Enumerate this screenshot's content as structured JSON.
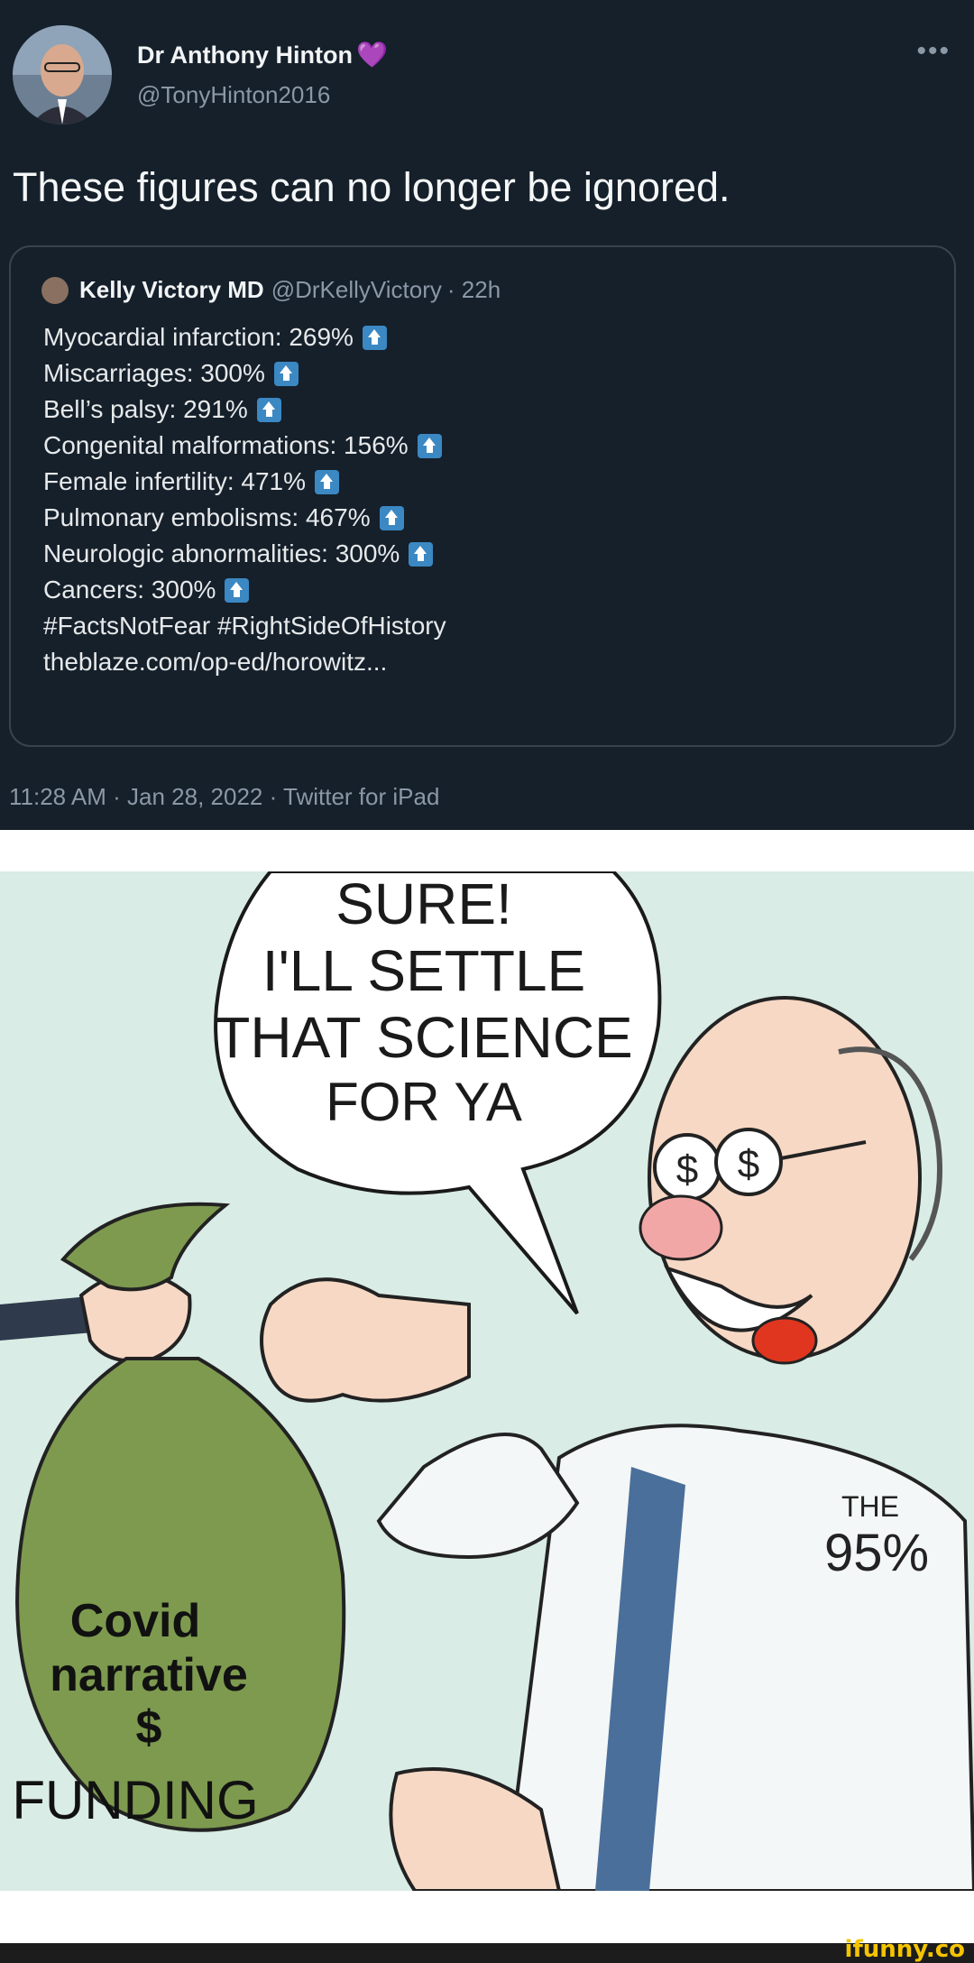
{
  "tweet": {
    "author_name": "Dr Anthony Hinton",
    "author_badge": "💜",
    "author_handle": "@TonyHinton2016",
    "more_icon": "•••",
    "text": "These figures can no longer be ignored.",
    "timestamp": "11:28 AM · Jan 28, 2022 · Twitter for iPad"
  },
  "quote": {
    "author_name": "Kelly Victory MD",
    "author_handle": "@DrKellyVictory",
    "time": "· 22h",
    "lines": [
      {
        "text": "Myocardial infarction: 269%",
        "arrow": true
      },
      {
        "text": "Miscarriages: 300%",
        "arrow": true
      },
      {
        "text": "Bell’s palsy: 291%",
        "arrow": true
      },
      {
        "text": "Congenital malformations: 156%",
        "arrow": true
      },
      {
        "text": "Female infertility: 471%",
        "arrow": true
      },
      {
        "text": "Pulmonary embolisms: 467%",
        "arrow": true
      },
      {
        "text": "Neurologic abnormalities: 300%",
        "arrow": true
      },
      {
        "text": "Cancers: 300%",
        "arrow": true
      },
      {
        "text": "#FactsNotFear #RightSideOfHistory",
        "arrow": false
      },
      {
        "text": "theblaze.com/op-ed/horowitz...",
        "arrow": false
      }
    ]
  },
  "cartoon": {
    "speech_lines": [
      "SURE!",
      "I'LL SETTLE",
      "THAT SCIENCE",
      "FOR YA"
    ],
    "bag_lines": [
      "Covid",
      "narrative",
      "$",
      "FUNDING"
    ],
    "coat_lines": [
      "THE",
      "95%"
    ],
    "colors": {
      "background": "#d9ece5",
      "bag": "#7d9a4f",
      "coat": "#f4f7f7"
    }
  },
  "footer": {
    "brand": "ifunny.co"
  }
}
